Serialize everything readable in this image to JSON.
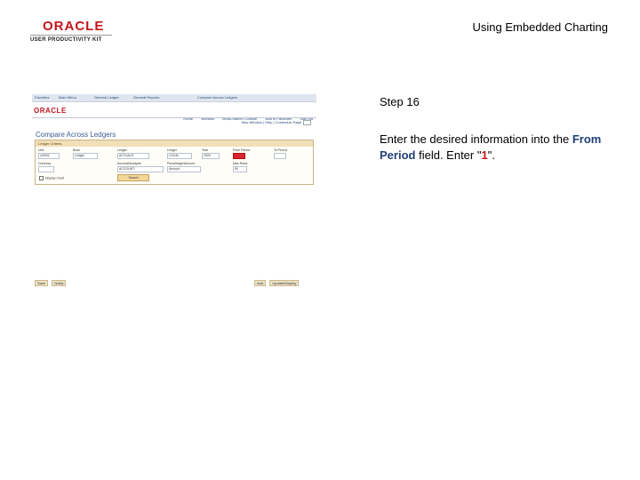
{
  "header": {
    "logo_text": "ORACLE",
    "logo_subtext": "USER PRODUCTIVITY KIT",
    "title": "Using Embedded Charting"
  },
  "screenshot": {
    "nav_links": [
      "Favorites",
      "Main Menu",
      "General Ledger",
      "General Reports",
      "Compare Across Ledgers"
    ],
    "brand": "ORACLE",
    "top_links": [
      "Home",
      "Worklist",
      "MultiChannel Console",
      "Add to Favorites",
      "Sign out"
    ],
    "sub_links": "New Window | Help | Customize Page",
    "heading": "Compare Across Ledgers",
    "panel_title": "Ledger Criteria",
    "fields": {
      "unit": {
        "label": "Unit",
        "value": "US001"
      },
      "book": {
        "label": "Book",
        "value": "Ledger"
      },
      "ledger1": {
        "label": "Ledger",
        "value": "ACTUALS"
      },
      "ledger2": {
        "label": "Ledger",
        "value": "LOCAL"
      },
      "year": {
        "label": "Year",
        "value": "2009"
      },
      "from_period": {
        "label": "From Period",
        "value": ""
      },
      "to_period": {
        "label": "To Period",
        "value": ""
      },
      "currency": {
        "label": "Currency",
        "value": ""
      },
      "account_field": {
        "label": "Account/Analysis",
        "value": "ACCOUNT"
      },
      "percentage": {
        "label": "Percentage/Amount",
        "value": "Amount"
      },
      "max_rows": {
        "label": "Max Rows",
        "value": "50"
      }
    },
    "display_chart": "Display Chart",
    "search_label": "Search",
    "bottom_left": [
      "Save",
      "Notify"
    ],
    "bottom_right": [
      "Add",
      "Update/Display"
    ]
  },
  "step": {
    "label": "Step 16",
    "instruction_prefix": "Enter the desired information into the",
    "field_name": "From Period",
    "instruction_mid": "field. Enter \"",
    "value": "1",
    "instruction_suffix": "\"."
  }
}
